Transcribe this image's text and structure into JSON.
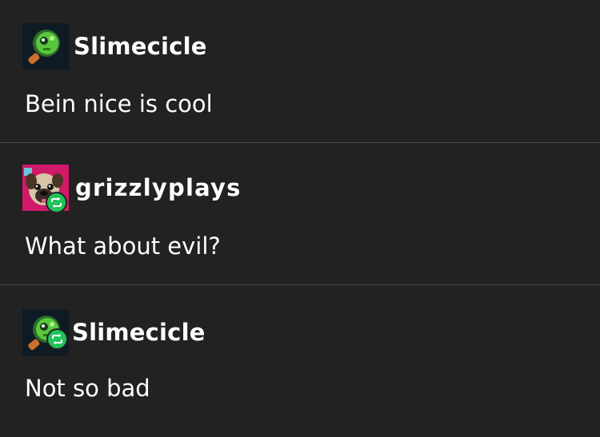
{
  "thread": {
    "posts": [
      {
        "username": "Slimecicle",
        "avatar_icon": "slime-magnifier-avatar-icon",
        "reblog": false,
        "text": "Bein nice is cool"
      },
      {
        "username": "grizzlyplays",
        "avatar_icon": "pug-avatar-icon",
        "reblog": true,
        "text": "What about evil?"
      },
      {
        "username": "Slimecicle",
        "avatar_icon": "slime-magnifier-avatar-icon",
        "reblog": true,
        "text": "Not so bad"
      }
    ]
  },
  "colors": {
    "background": "#222222",
    "divider": "#4a4a4a",
    "text": "#ffffff",
    "reblog_badge": "#21c35a"
  }
}
